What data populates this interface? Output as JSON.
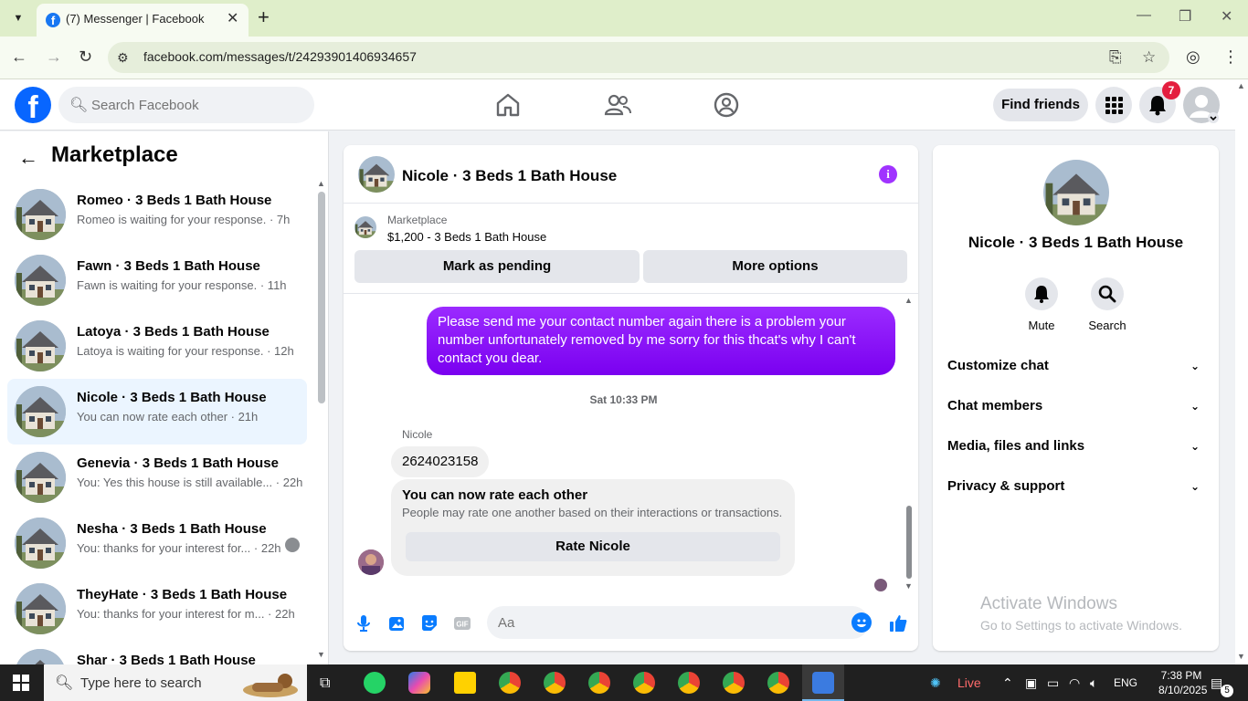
{
  "browser": {
    "tab_title": "(7) Messenger | Facebook",
    "url": "facebook.com/messages/t/24293901406934657"
  },
  "header": {
    "search_placeholder": "Search Facebook",
    "find_friends": "Find friends",
    "notification_count": "7"
  },
  "sidebar": {
    "title": "Marketplace",
    "conversations": [
      {
        "name": "Romeo · 3 Beds 1 Bath House",
        "preview": "Romeo is waiting for your response. · 7h"
      },
      {
        "name": "Fawn · 3 Beds 1 Bath House",
        "preview": "Fawn is waiting for your response. · 11h"
      },
      {
        "name": "Latoya · 3 Beds 1 Bath House",
        "preview": "Latoya is waiting for your response. · 12h"
      },
      {
        "name": "Nicole · 3 Beds 1 Bath House",
        "preview": "You can now rate each other · 21h",
        "active": true
      },
      {
        "name": "Genevia · 3 Beds 1 Bath House",
        "preview": "You: Yes this house is still available... · 22h"
      },
      {
        "name": "Nesha · 3 Beds 1 Bath House",
        "preview": "You: thanks for your interest for... · 22h"
      },
      {
        "name": "TheyHate · 3 Beds 1 Bath House",
        "preview": "You: thanks for your interest for m... · 22h"
      },
      {
        "name": "Shar · 3 Beds 1 Bath House",
        "preview": ""
      }
    ]
  },
  "chat": {
    "title": "Nicole · 3 Beds 1 Bath House",
    "marketplace_label": "Marketplace",
    "listing": "$1,200 - 3 Beds 1 Bath House",
    "mark_pending": "Mark as pending",
    "more_options": "More options",
    "outgoing_message": "Please send me your contact number again there is a problem your number unfortunately removed by me sorry for this thcat's why I can't contact you dear.",
    "timestamp": "Sat 10:33 PM",
    "sender_name": "Nicole",
    "incoming_message": "2624023158",
    "rate_title": "You can now rate each other",
    "rate_desc": "People may rate one another based on their interactions or transactions.",
    "rate_button": "Rate Nicole",
    "composer_placeholder": "Aa",
    "accent_color": "#8b00ff"
  },
  "info_panel": {
    "name": "Nicole · 3 Beds 1 Bath House",
    "mute_label": "Mute",
    "search_label": "Search",
    "sections": [
      "Customize chat",
      "Chat members",
      "Media, files and links",
      "Privacy & support"
    ]
  },
  "watermark": {
    "line1": "Activate Windows",
    "line2": "Go to Settings to activate Windows."
  },
  "taskbar": {
    "search_placeholder": "Type here to search",
    "live_label": "Live",
    "language": "ENG",
    "time": "7:38 PM",
    "date": "8/10/2025",
    "notification_count": "5"
  }
}
